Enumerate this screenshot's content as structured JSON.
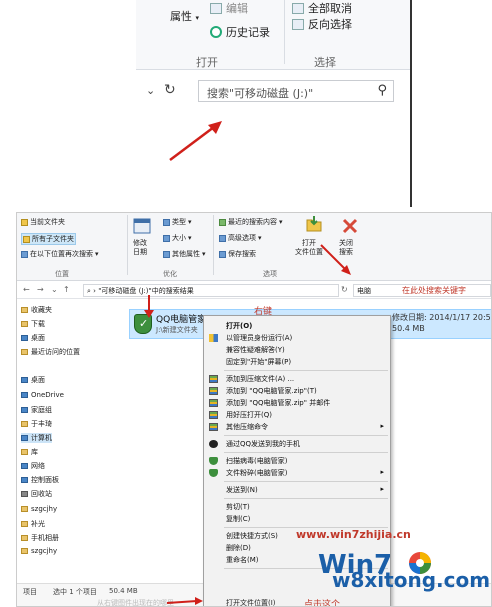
{
  "top": {
    "ribbon": {
      "properties": "属性",
      "edit": "编辑",
      "history": "历史记录",
      "open_group": "打开",
      "select_all_partial": "全部取消",
      "invert_selection": "反向选择",
      "select_group": "选择"
    },
    "search_placeholder": "搜索\"可移动磁盘 (J:)\""
  },
  "bottom": {
    "ribbon": {
      "current_folder": "当前文件夹",
      "all_subfolders": "所有子文件夹",
      "search_again_in": "在以下位置再次搜索",
      "location_group": "位置",
      "modified_date": "修改\n日期",
      "kind": "类型",
      "size": "大小",
      "other_props": "其他属性",
      "refine_group": "优化",
      "recent_searches": "最近的搜索内容",
      "advanced_options": "高级选项",
      "save_search": "保存搜索",
      "open_file_location": "打开\n文件位置",
      "close_search": "关闭\n搜索",
      "options_group": "选项"
    },
    "address": {
      "path": "\"可移动磁盘 (J:)\"中的搜索结果",
      "search_value": "电脑",
      "search_hint": "在此处搜索关键字"
    },
    "nav": [
      "收藏夹",
      "下载",
      "桌面",
      "最近访问的位置",
      "桌面",
      "OneDrive",
      "家庭组",
      "于丰琦",
      "计算机",
      "库",
      "网络",
      "控制面板",
      "回收站",
      "szgcjhy",
      "补光",
      "手机相册",
      "szgcjhy"
    ],
    "file": {
      "name": "QQ电脑管家",
      "subfolder": "J:\\新建文件夹",
      "date": "修改日期: 2014/1/17 20:59",
      "size": "50.4 MB",
      "right_click_note": "右键"
    },
    "status": {
      "count": "项目",
      "selected": "选中 1 个项目",
      "size": "50.4 MB"
    },
    "menu": [
      {
        "label": "打开(O)",
        "bold": true,
        "icon": ""
      },
      {
        "label": "以管理员身份运行(A)",
        "icon": "uac"
      },
      {
        "label": "兼容性疑难解答(Y)",
        "icon": ""
      },
      {
        "label": "固定到\"开始\"屏幕(P)",
        "icon": ""
      },
      {
        "label": "添加到压缩文件(A) ...",
        "icon": "rar"
      },
      {
        "label": "添加到 \"QQ电脑管家.zip\"(T)",
        "icon": "rar"
      },
      {
        "label": "添加到 \"QQ电脑管家.zip\" 并邮件",
        "icon": "rar"
      },
      {
        "label": "用好压打开(Q)",
        "icon": "rar"
      },
      {
        "label": "其他压缩命令",
        "icon": "rar",
        "submenu": true
      },
      {
        "label": "通过QQ发送到我的手机",
        "icon": "qq"
      },
      {
        "label": "扫描病毒(电脑管家)",
        "icon": "shield"
      },
      {
        "label": "文件粉碎(电脑管家)",
        "icon": "shield",
        "submenu": true
      },
      {
        "label": "发送到(N)",
        "icon": "",
        "submenu": true
      },
      {
        "label": "剪切(T)",
        "icon": ""
      },
      {
        "label": "复制(C)",
        "icon": ""
      },
      {
        "label": "创建快捷方式(S)",
        "icon": ""
      },
      {
        "label": "删除(D)",
        "icon": ""
      },
      {
        "label": "重命名(M)",
        "icon": ""
      }
    ],
    "menu_last": "打开文件位置(I)",
    "click_note": "点击这个",
    "footer_dim": "从右键图件出现在的哪里"
  },
  "watermark": {
    "url": "www.win7zhijia.cn",
    "brand": "w8xitong.com",
    "logo": "Win7"
  },
  "colors": {
    "annotation_red": "#c0392b",
    "selection_blue": "#cce8ff",
    "ribbon_bg": "#f5f6f8"
  }
}
